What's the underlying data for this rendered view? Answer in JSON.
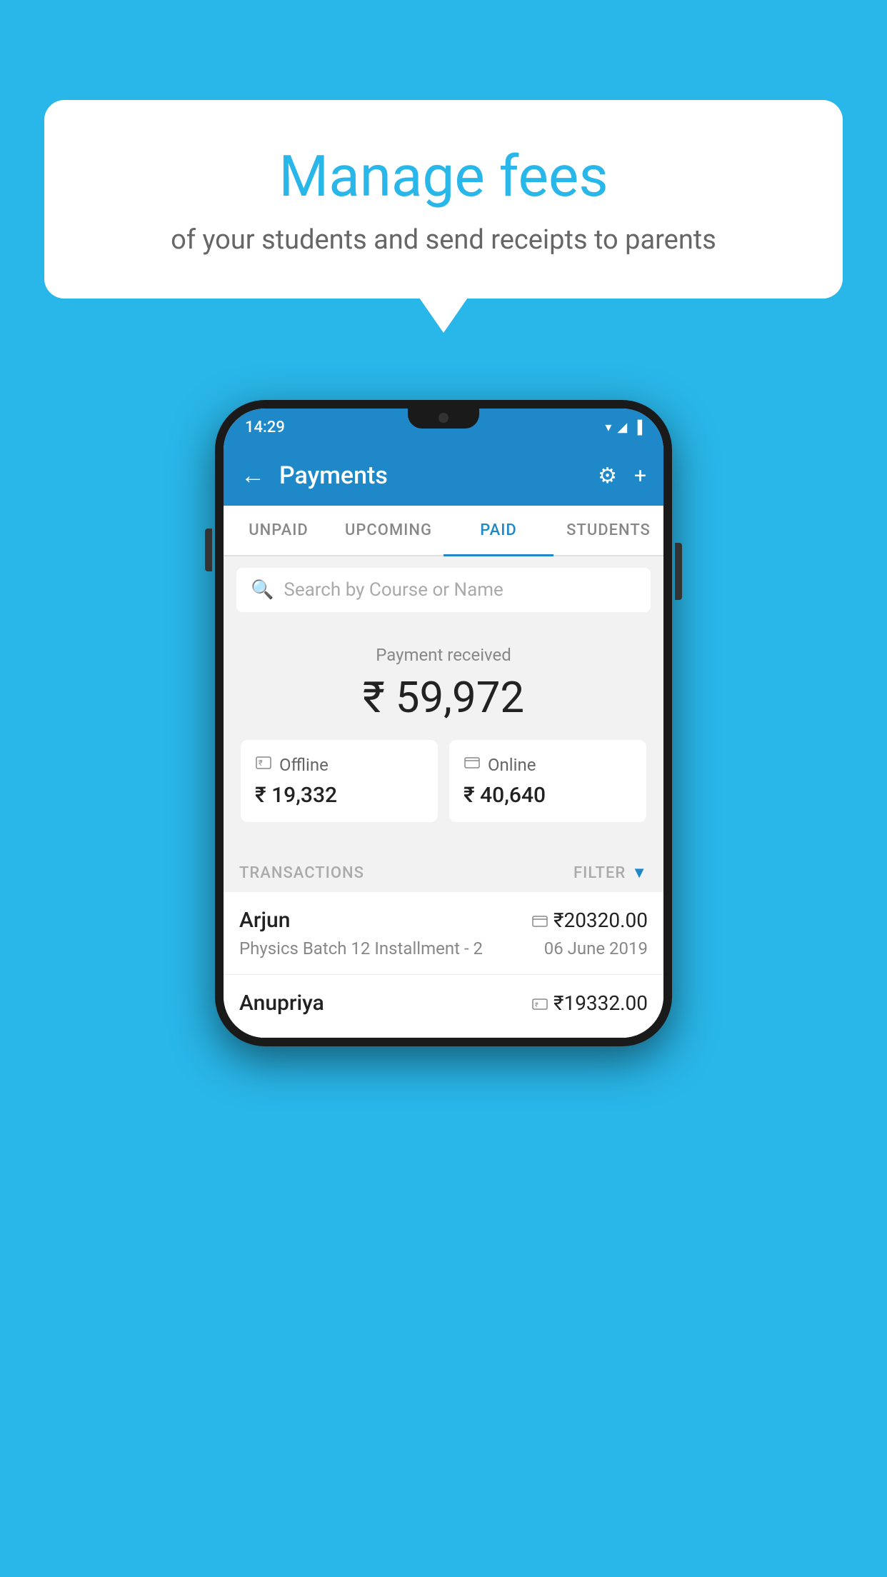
{
  "page": {
    "background_color": "#29b6e8"
  },
  "bubble": {
    "title": "Manage fees",
    "subtitle": "of your students and send receipts to parents"
  },
  "status_bar": {
    "time": "14:29",
    "wifi_icon": "▼",
    "signal_icon": "▲",
    "battery_icon": "▐"
  },
  "app_bar": {
    "title": "Payments",
    "back_label": "←",
    "gear_label": "⚙",
    "plus_label": "+"
  },
  "tabs": [
    {
      "id": "unpaid",
      "label": "UNPAID",
      "active": false
    },
    {
      "id": "upcoming",
      "label": "UPCOMING",
      "active": false
    },
    {
      "id": "paid",
      "label": "PAID",
      "active": true
    },
    {
      "id": "students",
      "label": "STUDENTS",
      "active": false
    }
  ],
  "search": {
    "placeholder": "Search by Course or Name"
  },
  "payment_received": {
    "label": "Payment received",
    "amount": "₹ 59,972",
    "offline": {
      "icon": "rupee-offline",
      "label": "Offline",
      "amount": "₹ 19,332"
    },
    "online": {
      "icon": "card-online",
      "label": "Online",
      "amount": "₹ 40,640"
    }
  },
  "transactions": {
    "header_label": "TRANSACTIONS",
    "filter_label": "FILTER",
    "items": [
      {
        "name": "Arjun",
        "course": "Physics Batch 12 Installment - 2",
        "date": "06 June 2019",
        "amount": "₹20320.00",
        "payment_type": "online"
      },
      {
        "name": "Anupriya",
        "course": "",
        "date": "",
        "amount": "₹19332.00",
        "payment_type": "offline"
      }
    ]
  }
}
